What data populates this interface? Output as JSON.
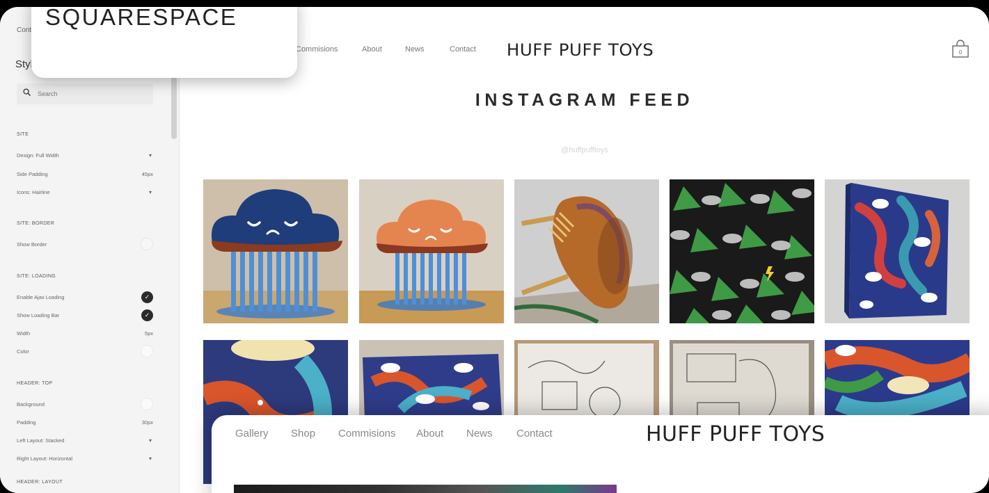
{
  "sidebar": {
    "back_label": "Cont",
    "title": "Styles",
    "search_placeholder": "Search",
    "sections": [
      {
        "title": "SITE",
        "rows": [
          {
            "label": "Design: Full Width",
            "control": "dropdown"
          },
          {
            "label": "Side Padding",
            "value": "45px"
          },
          {
            "label": "Icons: Hairline",
            "control": "dropdown"
          }
        ]
      },
      {
        "title": "SITE: BORDER",
        "rows": [
          {
            "label": "Show Border",
            "control": "toggle",
            "checked": false
          }
        ]
      },
      {
        "title": "SITE: LOADING",
        "rows": [
          {
            "label": "Enable Ajax Loading",
            "control": "toggle",
            "checked": true
          },
          {
            "label": "Show Loading Bar",
            "control": "toggle",
            "checked": true
          },
          {
            "label": "Width",
            "value": "5px"
          },
          {
            "label": "Color",
            "control": "swatch",
            "color": "#ffffff"
          }
        ]
      },
      {
        "title": "HEADER: TOP",
        "rows": [
          {
            "label": "Background",
            "control": "swatch",
            "color": "#ffffff"
          },
          {
            "label": "Padding",
            "value": "30px"
          },
          {
            "label": "Left Layout: Stacked",
            "control": "dropdown"
          },
          {
            "label": "Right Layout: Horizontal",
            "control": "dropdown"
          }
        ]
      },
      {
        "title": "HEADER: LAYOUT",
        "rows": []
      }
    ]
  },
  "logo_card": {
    "text": "SQUARESPACE"
  },
  "site": {
    "nav": [
      "Commisions",
      "About",
      "News",
      "Contact"
    ],
    "brand": "HUFF PUFF TOYS",
    "heading": "INSTAGRAM FEED",
    "feed_link": "@huffpufftoys",
    "gallery": [
      "navy-cloud-sculpture",
      "orange-cloud-sculpture",
      "hotdog-character-sculpture",
      "green-tree-cloud-pattern",
      "blue-mural-canvas",
      "dragon-cloud-mural",
      "cloud-mural-closeup",
      "pencil-sketch-page",
      "pencil-sketch-machine",
      "colorful-mural-detail"
    ]
  },
  "overlay": {
    "nav": [
      "Gallery",
      "Shop",
      "Commisions",
      "About",
      "News",
      "Contact"
    ],
    "brand": "HUFF PUFF TOYS"
  },
  "colors": {
    "background": "#000000",
    "sidebar": "#f4f4f4",
    "heading": "#2a2a2a",
    "toggle_on": "#2b2b2b"
  },
  "icons": {
    "search": "search-icon",
    "cart": "shopping-bag-icon",
    "check": "check-icon",
    "chevron": "chevron-down-icon"
  }
}
